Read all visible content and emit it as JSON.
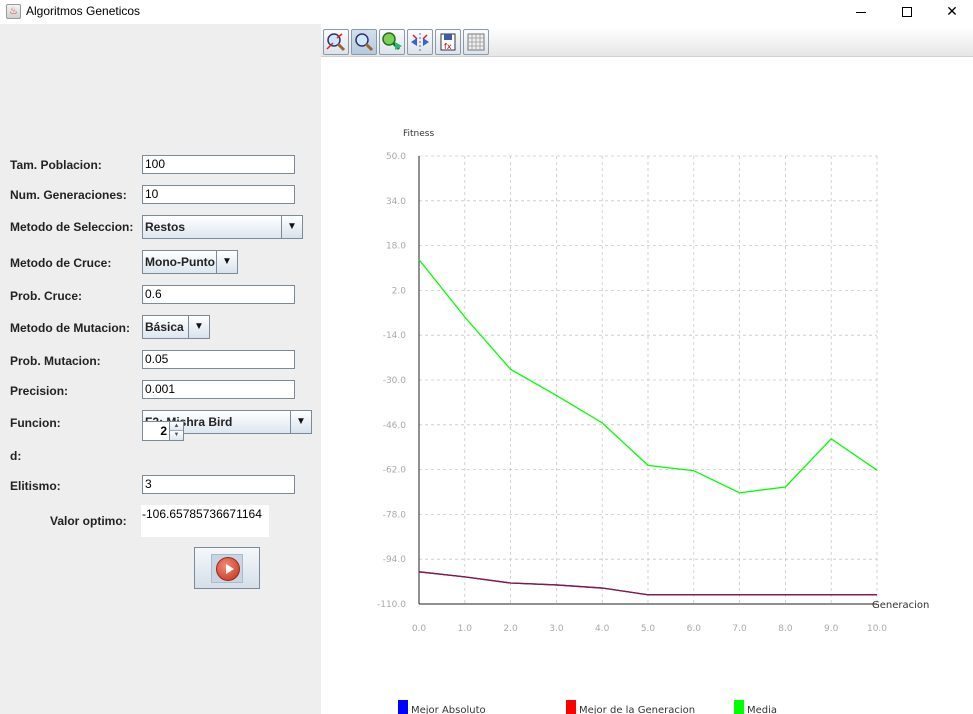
{
  "window": {
    "title": "Algoritmos Geneticos",
    "app_icon_glyph": "♨",
    "minimize_glyph": "—",
    "maximize_glyph": "☐",
    "close_glyph": "✕"
  },
  "form": {
    "tam_poblacion": {
      "label": "Tam. Poblacion:",
      "value": "100"
    },
    "num_generaciones": {
      "label": "Num. Generaciones:",
      "value": "10"
    },
    "metodo_seleccion": {
      "label": "Metodo de Seleccion:",
      "value": "Restos"
    },
    "metodo_cruce": {
      "label": "Metodo de Cruce:",
      "value": "Mono-Punto"
    },
    "prob_cruce": {
      "label": "Prob. Cruce:",
      "value": "0.6"
    },
    "metodo_mutacion": {
      "label": "Metodo de Mutacion:",
      "value": "Básica"
    },
    "prob_mutacion": {
      "label": "Prob. Mutacion:",
      "value": "0.05"
    },
    "precision": {
      "label": "Precision:",
      "value": "0.001"
    },
    "funcion": {
      "label": "Funcion:",
      "value": "F2: Mishra Bird"
    },
    "d": {
      "label": "d:",
      "value": "2"
    },
    "elitismo": {
      "label": "Elitismo:",
      "value": "3"
    },
    "valor_optimo": {
      "label": "Valor optimo:",
      "value": "-106.65785736671164"
    },
    "combo_arrow_glyph": "▼",
    "spin_up_glyph": "▲",
    "spin_down_glyph": "▼"
  },
  "toolbar": {
    "buttons": [
      "zoom-in-icon",
      "zoom-icon",
      "pan-icon",
      "fit-icon",
      "export-icon",
      "grid-icon"
    ]
  },
  "chart_data": {
    "type": "line",
    "ylabel": "Fitness",
    "xlabel": "Generacion",
    "x": [
      0,
      1,
      2,
      3,
      4,
      5,
      6,
      7,
      8,
      9,
      10
    ],
    "x_tick_labels": [
      "0.0",
      "1.0",
      "2.0",
      "3.0",
      "4.0",
      "5.0",
      "6.0",
      "7.0",
      "8.0",
      "9.0",
      "10.0"
    ],
    "y_tick_labels": [
      "50.0",
      "34.0",
      "18.0",
      "2.0",
      "-14.0",
      "-30.0",
      "-46.0",
      "-62.0",
      "-78.0",
      "-94.0",
      "-110.0"
    ],
    "xlim": [
      0,
      10
    ],
    "ylim": [
      -110,
      50
    ],
    "grid": true,
    "legend_position": "bottom",
    "series": [
      {
        "name": "Mejor Absoluto",
        "color": "#0000ff",
        "values": [
          -98.5,
          -100.3,
          -102.5,
          -103.2,
          -104.3,
          -106.7,
          -106.7,
          -106.7,
          -106.7,
          -106.7,
          -106.7
        ]
      },
      {
        "name": "Mejor de la Generacion",
        "color": "#ff0000",
        "values": [
          -98.5,
          -100.3,
          -102.5,
          -103.2,
          -104.3,
          -106.7,
          -106.7,
          -106.7,
          -106.7,
          -106.7,
          -106.7
        ]
      },
      {
        "name": "Media",
        "color": "#00ff00",
        "values": [
          13.0,
          -7.5,
          -26.2,
          -35.5,
          -45.3,
          -60.5,
          -62.4,
          -70.3,
          -68.2,
          -51.0,
          -62.2
        ]
      }
    ],
    "overlay_color": "#8b1a3a"
  }
}
